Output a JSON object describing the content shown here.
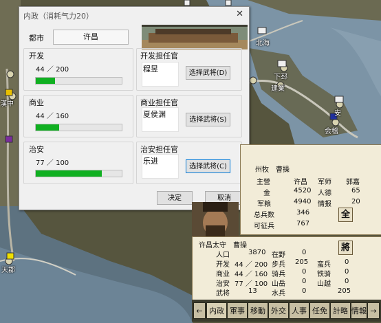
{
  "dialog": {
    "title": "内政（消耗气力20）",
    "city_label": "都市",
    "city_value": "许昌",
    "sections": [
      {
        "stat_label": "开发",
        "value_text": "44 ／ 200",
        "ratio": 0.22,
        "officer_label": "开发担任官",
        "officer": "程昱",
        "button": "选择武将(D)"
      },
      {
        "stat_label": "商业",
        "value_text": "44 ／ 160",
        "ratio": 0.275,
        "officer_label": "商业担任官",
        "officer": "夏侯渊",
        "button": "选择武将(S)"
      },
      {
        "stat_label": "治安",
        "value_text": "77 ／ 100",
        "ratio": 0.77,
        "officer_label": "治安担任官",
        "officer": "乐进",
        "button": "选择武将(C)"
      }
    ],
    "ok_button": "决定",
    "cancel_button": "取消"
  },
  "map_labels": [
    "北海",
    "下邳",
    "建業",
    "会稽",
    "安",
    "漢中",
    "天郡"
  ],
  "status_panel": {
    "governor_label": "州牧",
    "governor": "曹操",
    "header": [
      "主營",
      "许昌",
      "军师",
      "郭嘉"
    ],
    "rows": [
      [
        "金",
        "4520",
        "人德",
        "65"
      ],
      [
        "军粮",
        "4940",
        "情报",
        "20"
      ],
      [
        "总兵数",
        "346",
        "",
        ""
      ],
      [
        "可征兵",
        "767",
        "",
        ""
      ]
    ],
    "side_button_all": "全",
    "side_button_general": "將",
    "prefect_title": "许昌太守",
    "prefect": "曹操",
    "city_rows": [
      [
        "人口",
        "3870",
        "在野",
        "0",
        "",
        ""
      ],
      [
        "开发",
        "44 ／ 200",
        "步兵",
        "205",
        "蛮兵",
        "0"
      ],
      [
        "商业",
        "44 ／ 160",
        "骑兵",
        "0",
        "铁骑",
        "0"
      ],
      [
        "治安",
        "77 ／ 100",
        "山岳",
        "0",
        "山越",
        "0"
      ],
      [
        "武将",
        "13",
        "水兵",
        "0",
        "",
        "205"
      ]
    ]
  },
  "command_bar": {
    "left_arrow": "←",
    "items": [
      "内政",
      "軍事",
      "移動",
      "外交",
      "人事",
      "任免",
      "計略",
      "情報"
    ],
    "right_arrow": "→"
  },
  "colors": {
    "progress": "#10b021",
    "dialog_bg": "#f0f0f0",
    "panel_bg": "#f2ecd8"
  }
}
